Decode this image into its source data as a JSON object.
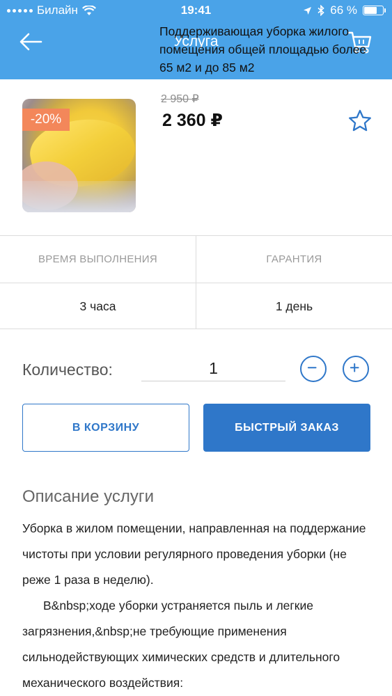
{
  "status_bar": {
    "carrier": "Билайн",
    "time": "19:41",
    "battery": "66 %",
    "battery_level": 0.66
  },
  "nav": {
    "title": "Услуга"
  },
  "product": {
    "discount": "-20%",
    "title": "Поддерживающая уборка жилого помещения общей площадью более 65 м2 и до 85 м2",
    "old_price": "2 950 ₽",
    "price": "2 360 ₽"
  },
  "info": {
    "headers": [
      "ВРЕМЯ ВЫПОЛНЕНИЯ",
      "ГАРАНТИЯ"
    ],
    "values": [
      "3 часа",
      "1 день"
    ]
  },
  "quantity": {
    "label": "Количество:",
    "value": "1"
  },
  "buttons": {
    "add_to_cart": "В КОРЗИНУ",
    "quick_order": "БЫСТРЫЙ ЗАКАЗ"
  },
  "description": {
    "title": "Описание услуги",
    "paragraph1": "Уборка в жилом помещении, направленная на поддержание чистоты при условии регулярного проведения уборки (не реже 1 раза в неделю).",
    "paragraph2": "B&nbsp;ходе уборки устраняется пыль и легкие загрязнения,&nbsp;не требующие применения сильнодействующих химических средств и длительного механического воздействия:"
  },
  "colors": {
    "header_bg": "#4aa3e8",
    "primary": "#2f77c9",
    "discount_badge": "#f3875a"
  },
  "icons": [
    "signal-icon",
    "wifi-icon",
    "location-icon",
    "bluetooth-icon",
    "battery-icon",
    "back-arrow-icon",
    "cart-icon",
    "star-icon",
    "minus-icon",
    "plus-icon"
  ]
}
